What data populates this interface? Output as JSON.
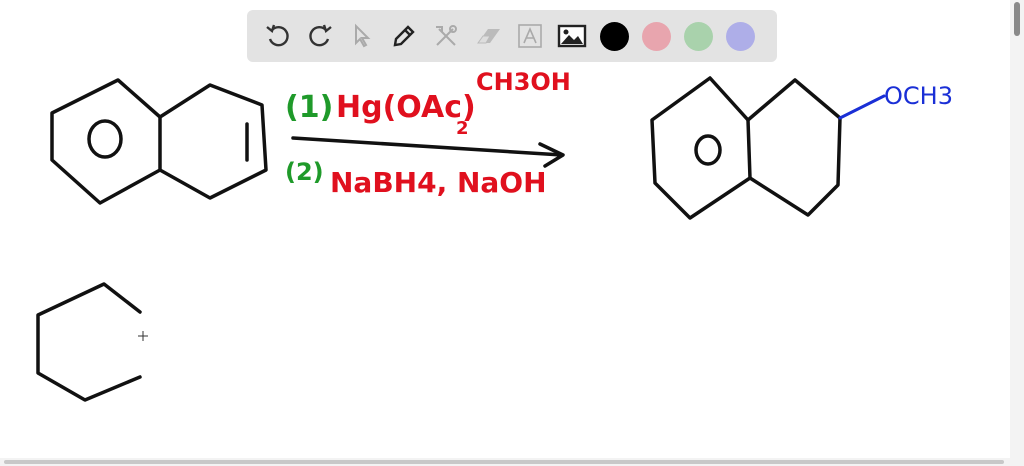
{
  "toolbar": {
    "tools": [
      "undo-icon",
      "redo-icon",
      "select-icon",
      "pen-icon",
      "tools-icon",
      "eraser-icon",
      "text-icon",
      "image-icon"
    ],
    "colors": [
      "#000000",
      "#e8a5ae",
      "#a9d2ac",
      "#aeaee8"
    ]
  },
  "canvas": {
    "step1_label": "(1)",
    "step1_reagent": "Hg(OAc)",
    "step1_subscript": "2",
    "solvent": "CH3OH",
    "step2_label": "(2)",
    "step2_reagent": "NaBH4, NaOH",
    "product_group": "OCH3",
    "ink_colors": {
      "black": "#111111",
      "green": "#1f9a2a",
      "red": "#e0101e",
      "blue": "#1a2fd6"
    }
  }
}
